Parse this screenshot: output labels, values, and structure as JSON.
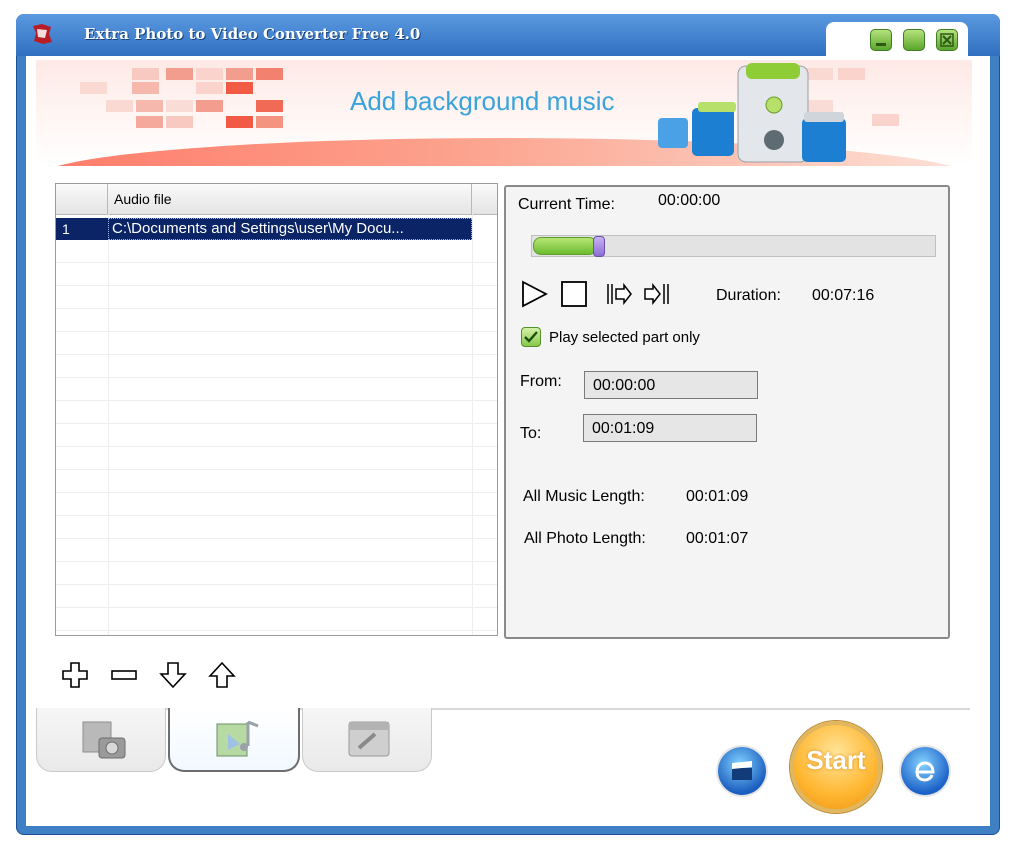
{
  "window": {
    "title": "Extra Photo to Video Converter Free 4.0"
  },
  "banner": {
    "heading": "Add background music"
  },
  "audio_list": {
    "column_header": "Audio file",
    "rows": [
      {
        "num": "1",
        "path": "C:\\Documents and Settings\\user\\My Docu..."
      }
    ]
  },
  "list_buttons": [
    "add-icon",
    "remove-icon",
    "move-down-icon",
    "move-up-icon"
  ],
  "player": {
    "current_time_label": "Current Time:",
    "current_time_value": "00:00:00",
    "duration_label": "Duration:",
    "duration_value": "00:07:16",
    "play_selected_label": "Play selected part only",
    "play_selected_checked": true,
    "from_label": "From:",
    "from_value": "00:00:00",
    "to_label": "To:",
    "to_value": "00:01:09",
    "all_music_label": "All Music Length:",
    "all_music_value": "00:01:09",
    "all_photo_label": "All Photo Length:",
    "all_photo_value": "00:01:07"
  },
  "start_button": {
    "label": "Start"
  },
  "colors": {
    "title_bar": "#3f7fc4",
    "banner_text": "#39a3da",
    "selection": "#0b2466",
    "accent_green": "#6cbc2e",
    "start_orange": "#ffb732"
  }
}
